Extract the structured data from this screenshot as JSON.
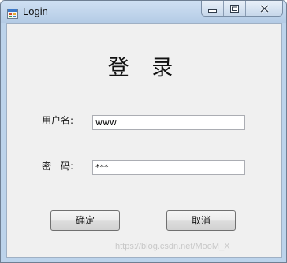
{
  "window": {
    "title": "Login",
    "icons": {
      "app": "windows-form-icon",
      "minimize": "minimize-icon",
      "maximize": "maximize-icon",
      "close": "close-icon"
    }
  },
  "form": {
    "heading": "登 录",
    "username_label": "用户名:",
    "username_value": "www",
    "password_label": "密　码:",
    "password_value": "***"
  },
  "buttons": {
    "confirm": "确定",
    "cancel": "取消"
  },
  "watermark": "https://blog.csdn.net/MooM_X"
}
